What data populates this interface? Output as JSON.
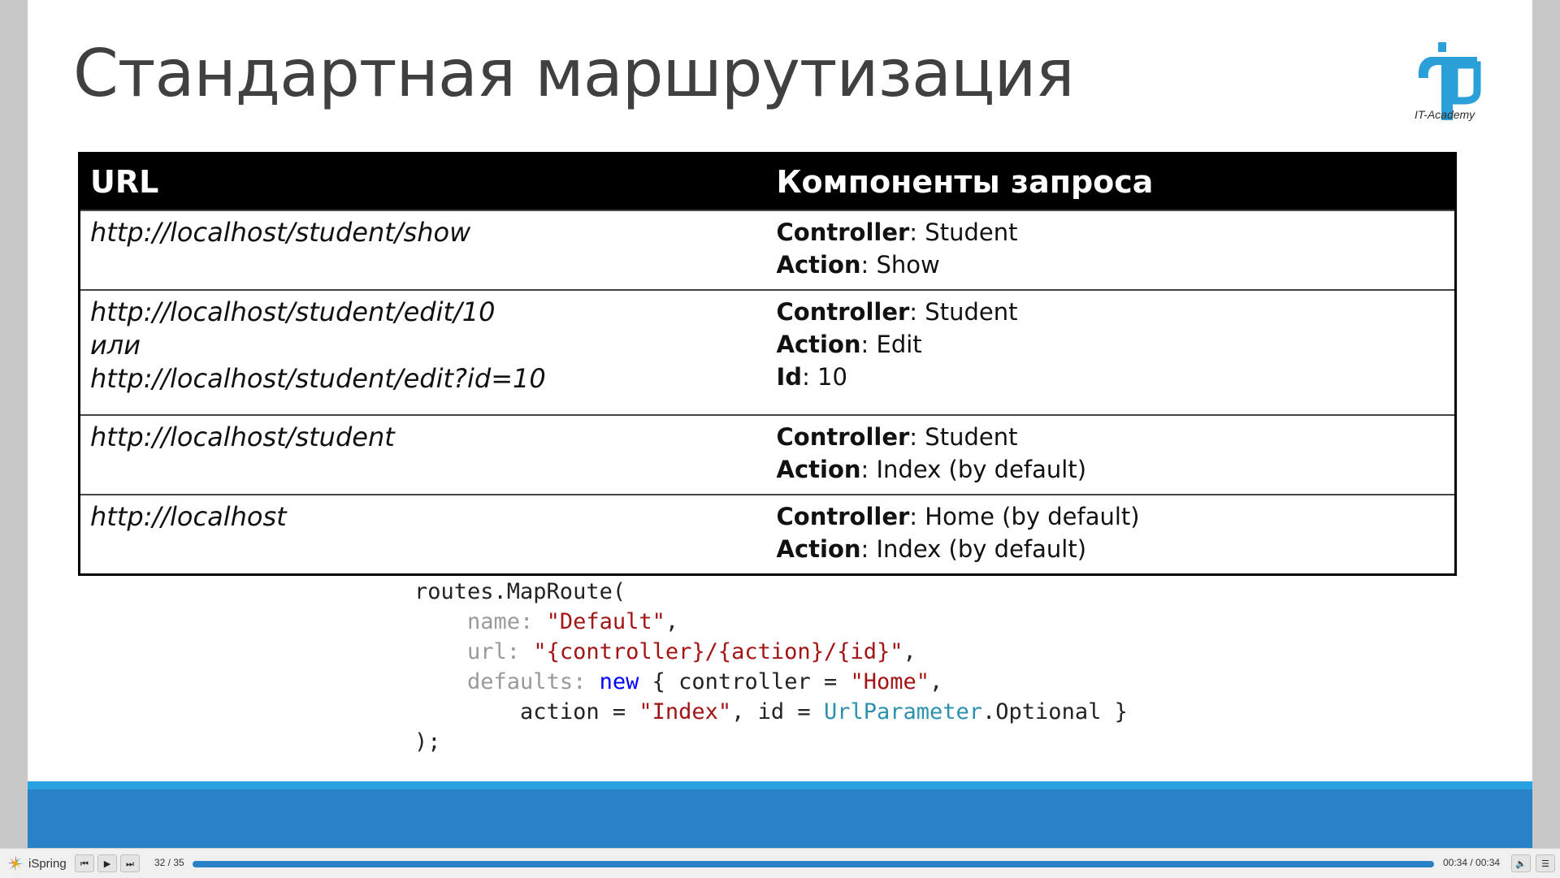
{
  "slide": {
    "title": "Стандартная маршрутизация",
    "logo_text": "IT-Academy",
    "table": {
      "headers": [
        "URL",
        "Компоненты запроса"
      ],
      "rows": [
        {
          "urls": [
            "http://localhost/student/show"
          ],
          "components": [
            {
              "key": "Controller",
              "value": ": Student"
            },
            {
              "key": "Action",
              "value": ": Show"
            }
          ]
        },
        {
          "urls": [
            "http://localhost/student/edit/10",
            "или",
            "http://localhost/student/edit?id=10"
          ],
          "components": [
            {
              "key": "Controller",
              "value": ": Student"
            },
            {
              "key": "Action",
              "value": ": Edit"
            },
            {
              "key": "Id",
              "value": ": 10"
            }
          ]
        },
        {
          "urls": [
            "http://localhost/student"
          ],
          "components": [
            {
              "key": "Controller",
              "value": ": Student"
            },
            {
              "key": "Action",
              "value": ": Index (by default)"
            }
          ]
        },
        {
          "urls": [
            "http://localhost"
          ],
          "components": [
            {
              "key": "Controller",
              "value": ": Home (by default)"
            },
            {
              "key": "Action",
              "value": ": Index (by default)"
            }
          ]
        }
      ]
    },
    "code": {
      "line1": "routes.MapRoute(",
      "name_key": "name:",
      "name_value": "\"Default\"",
      "url_key": "url:",
      "url_value": "\"{controller}/{action}/{id}\"",
      "defaults_key": "defaults:",
      "new_kw": "new",
      "defaults_open": "{ controller = ",
      "controller_value": "\"Home\"",
      "action_prefix": "action = ",
      "action_value": "\"Index\"",
      "id_prefix": ", id = ",
      "urlparam_type": "UrlParameter",
      "optional_suffix": ".Optional }",
      "close": ");"
    }
  },
  "player": {
    "brand": "iSpring",
    "counter": "32 / 35",
    "time": "00:34 / 00:34",
    "progress": 1.0,
    "icons": {
      "prev": "skip-back-icon",
      "play": "play-icon",
      "next": "skip-forward-icon",
      "volume": "volume-icon",
      "menu": "menu-icon"
    }
  },
  "colors": {
    "band": "#2a82c6",
    "band_top": "#29a0e0",
    "logo": "#2a9fd8"
  }
}
